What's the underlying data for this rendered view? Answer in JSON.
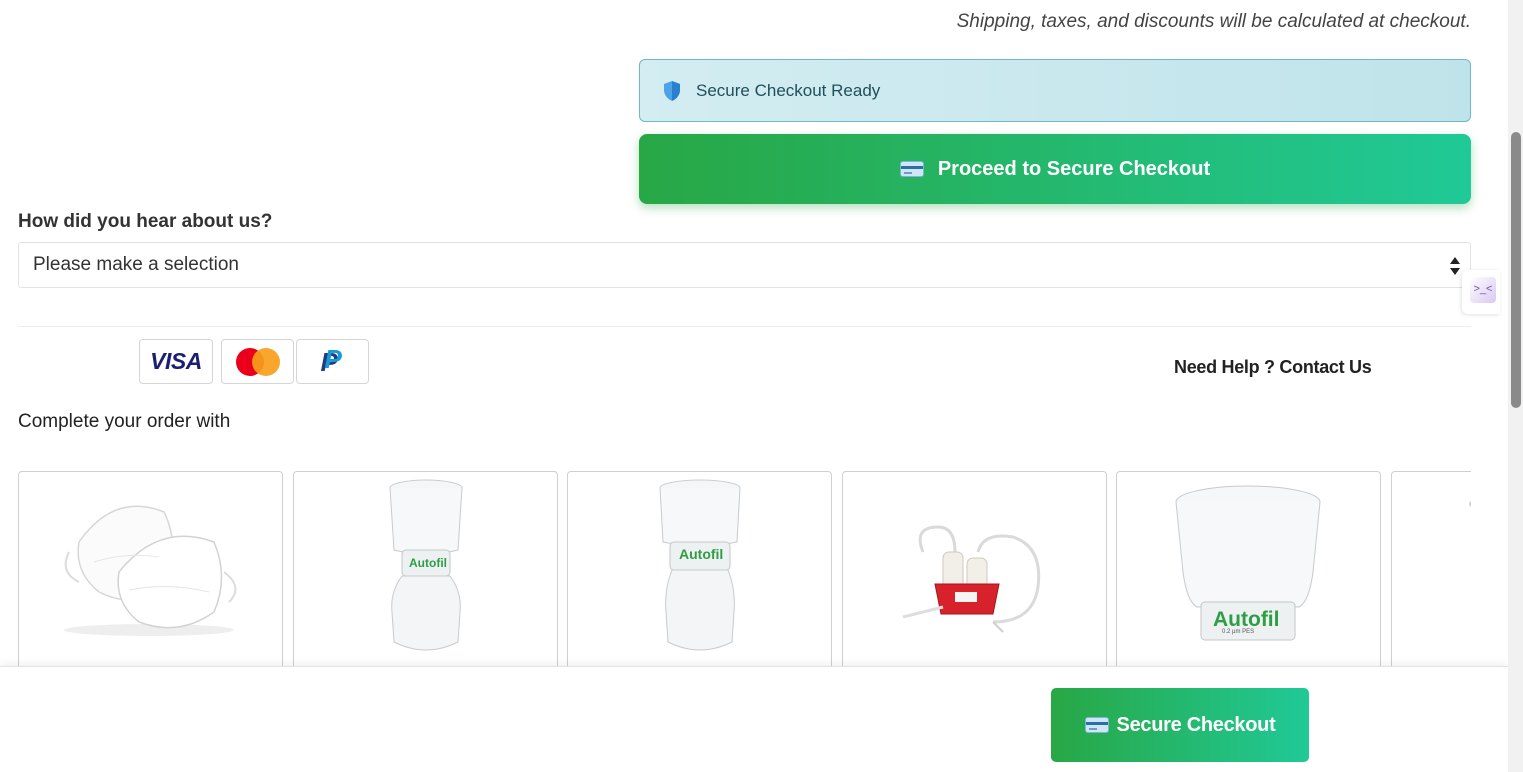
{
  "cart": {
    "shipping_note": "Shipping, taxes, and discounts will be calculated at checkout.",
    "secure_ready_text": "Secure Checkout Ready",
    "secure_ready_icon": "shield-icon",
    "proceed_label": "Proceed to Secure Checkout",
    "proceed_icon": "credit-card-icon"
  },
  "referral": {
    "label": "How did you hear about us?",
    "selected_value": "Please make a selection"
  },
  "payment_methods": [
    "VISA",
    "Mastercard",
    "PayPal"
  ],
  "help": {
    "link_text": "Need Help ? Contact Us"
  },
  "upsell": {
    "heading": "Complete your order with",
    "products": [
      {
        "image": "face-masks"
      },
      {
        "image": "autofil-filter-bottle",
        "brand_text": "Autofil"
      },
      {
        "image": "autofil-filter-bottle",
        "brand_text": "Autofil"
      },
      {
        "image": "vacuum-aspiration-system"
      },
      {
        "image": "autofil-filter-funnel",
        "brand_text": "Autofil",
        "sub_text": "0.2 µm PES"
      },
      {
        "image": "partial-product"
      }
    ]
  },
  "sticky_bar": {
    "button_label": "Secure Checkout",
    "button_icon": "credit-card-icon"
  },
  "colors": {
    "checkout_gradient_start": "#28a745",
    "checkout_gradient_end": "#20c997",
    "secure_ready_bg": "#c9e8ee",
    "secure_ready_border": "#6fb8c7"
  }
}
